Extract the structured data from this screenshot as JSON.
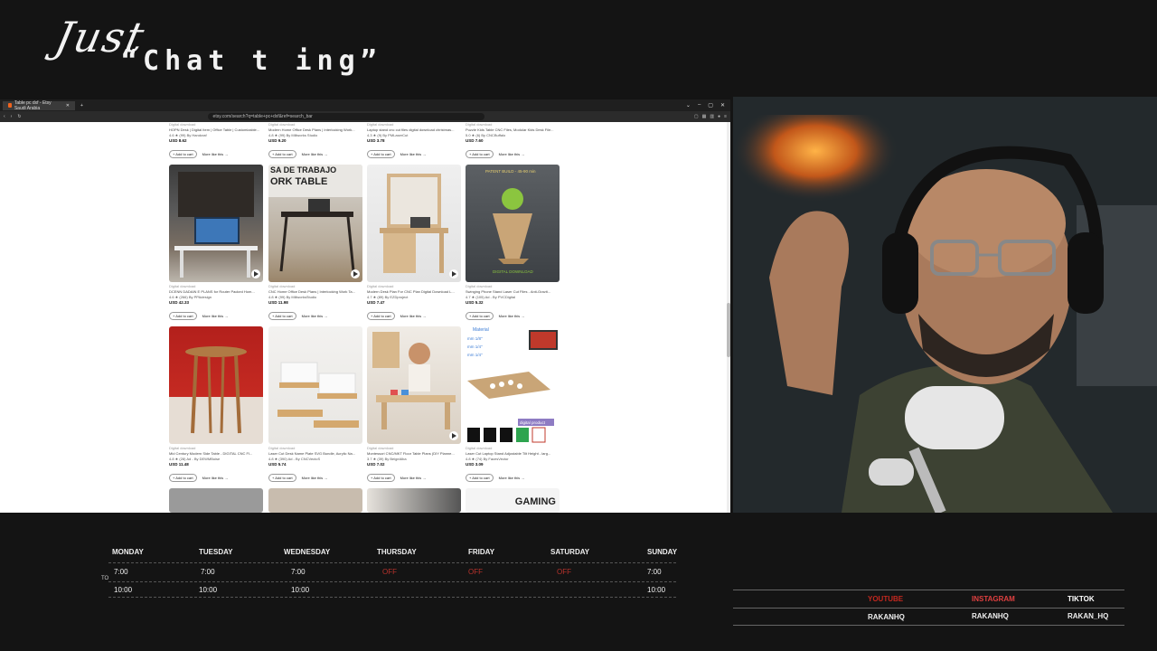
{
  "overlay": {
    "title_line1": "Just",
    "title_line2": "“Chat t ing”"
  },
  "browser": {
    "tab_title": "Table pc dxf - Etsy Saudi Arabia",
    "url": "etsy.com/search?q=table+pc+dxf&ref=search_bar",
    "window_controls": [
      "⌄",
      "–",
      "▢",
      "✕"
    ],
    "top_row": [
      {
        "dl": "Digital download",
        "name": "HOPN Desk | Digital Item | Office Table | Customizable...",
        "rate": "4.6 ★ (99) By Handcraf",
        "price": "USD 8.62"
      },
      {
        "dl": "Digital download",
        "name": "Modern Home Office Desk Plans | Interlocking Work...",
        "rate": "4.8 ★ (99) By Millworks Studio",
        "price": "USD 9.20"
      },
      {
        "dl": "Digital download",
        "name": "Laptop stand cnc cut files digital download christmas...",
        "rate": "4.3 ★ (9) By PMLaserCut",
        "price": "USD 3.78"
      },
      {
        "dl": "Digital download",
        "name": "Puzzle Kids Table CNC Files, Modular Kids Desk File...",
        "rate": "5.0 ★ (6) By CNCBuffalo",
        "price": "USD 7.60"
      }
    ],
    "rows": [
      [
        {
          "dl": "Digital download",
          "name": "DCENN DADAIN E PLANS for Router Packed Hom...",
          "rate": "4.6 ★ (266) By PPAdesign",
          "price": "USD 42.33",
          "video": true
        },
        {
          "dl": "Digital download",
          "name": "CNC Home Office Desk Plans | Interlocking Work Ta...",
          "rate": "4.8 ★ (99) By MillworksStudio",
          "price": "USD 11.98",
          "video": true,
          "overlay_text": [
            "SA DE TRABAJO",
            "ORK TABLE"
          ]
        },
        {
          "dl": "Digital download",
          "name": "Modern Desk Plan For CNC Plan Digital Download L...",
          "rate": "4.7 ★ (89) By EZDproject",
          "price": "USD 7.47",
          "video": true
        },
        {
          "dl": "Digital download",
          "name": "Swinging Phone Stand Laser Cut Files - Anti-Gravit...",
          "rate": "4.7 ★ (105) Ad - By PVCDigital",
          "price": "USD 5.32",
          "video": false,
          "overlay_text": [
            "PATENT BUILD - 45-90 min",
            "DIGITAL DOWNLOAD"
          ]
        }
      ],
      [
        {
          "dl": "Digital download",
          "name": "Mid Century Modern Side Table - DIGITAL CNC FI...",
          "rate": "4.8 ★ (28) Ad - By DEWMBoise",
          "price": "USD 11.48",
          "video": false
        },
        {
          "dl": "Digital download",
          "name": "Laser Cut Desk Name Plate SVG Bundle, Acrylic Na...",
          "rate": "4.8 ★ (390) Ad - By CNCVectoS",
          "price": "USD 5.74",
          "video": false
        },
        {
          "dl": "Digital download",
          "name": "Montessori CNC/MKT Floor Table Plans (DIY Planne...",
          "rate": "3.7 ★ (39) By BeigeAlba",
          "price": "USD 7.02",
          "video": true
        },
        {
          "dl": "Digital download",
          "name": "Laser Cut Laptop Stand Adjustable Tilt Height - larg...",
          "rate": "4.8 ★ (74) By FacesVector",
          "price": "USD 3.09",
          "video": false,
          "overlay_text": [
            "Material",
            "mm  1/8\"",
            "mm  1/4\"",
            "mm  1/4\"",
            "digital product"
          ]
        }
      ]
    ],
    "bottom_peek": [
      "",
      "",
      "",
      "GAMING"
    ],
    "add_to_cart": "+ Add to cart",
    "more_like": "More like this →"
  },
  "schedule": {
    "days": [
      "MONDAY",
      "TUESDAY",
      "WEDNESDAY",
      "THURSDAY",
      "FRIDAY",
      "SATURDAY",
      "SUNDAY"
    ],
    "start": [
      "7:00",
      "7:00",
      "7:00",
      "OFF",
      "OFF",
      "OFF",
      "7:00"
    ],
    "end": [
      "10:00",
      "10:00",
      "10:00",
      "",
      "",
      "",
      "10:00"
    ],
    "to_label": "TO"
  },
  "socials": {
    "platforms": [
      {
        "name": "YOUTUBE",
        "handle": "RAKANHQ",
        "color": "#c4281f"
      },
      {
        "name": "INSTAGRAM",
        "handle": "RAKANHQ",
        "color": "#e04040"
      },
      {
        "name": "TIKTOK",
        "handle": "RAKAN_HQ",
        "color": "#ffffff"
      }
    ]
  }
}
